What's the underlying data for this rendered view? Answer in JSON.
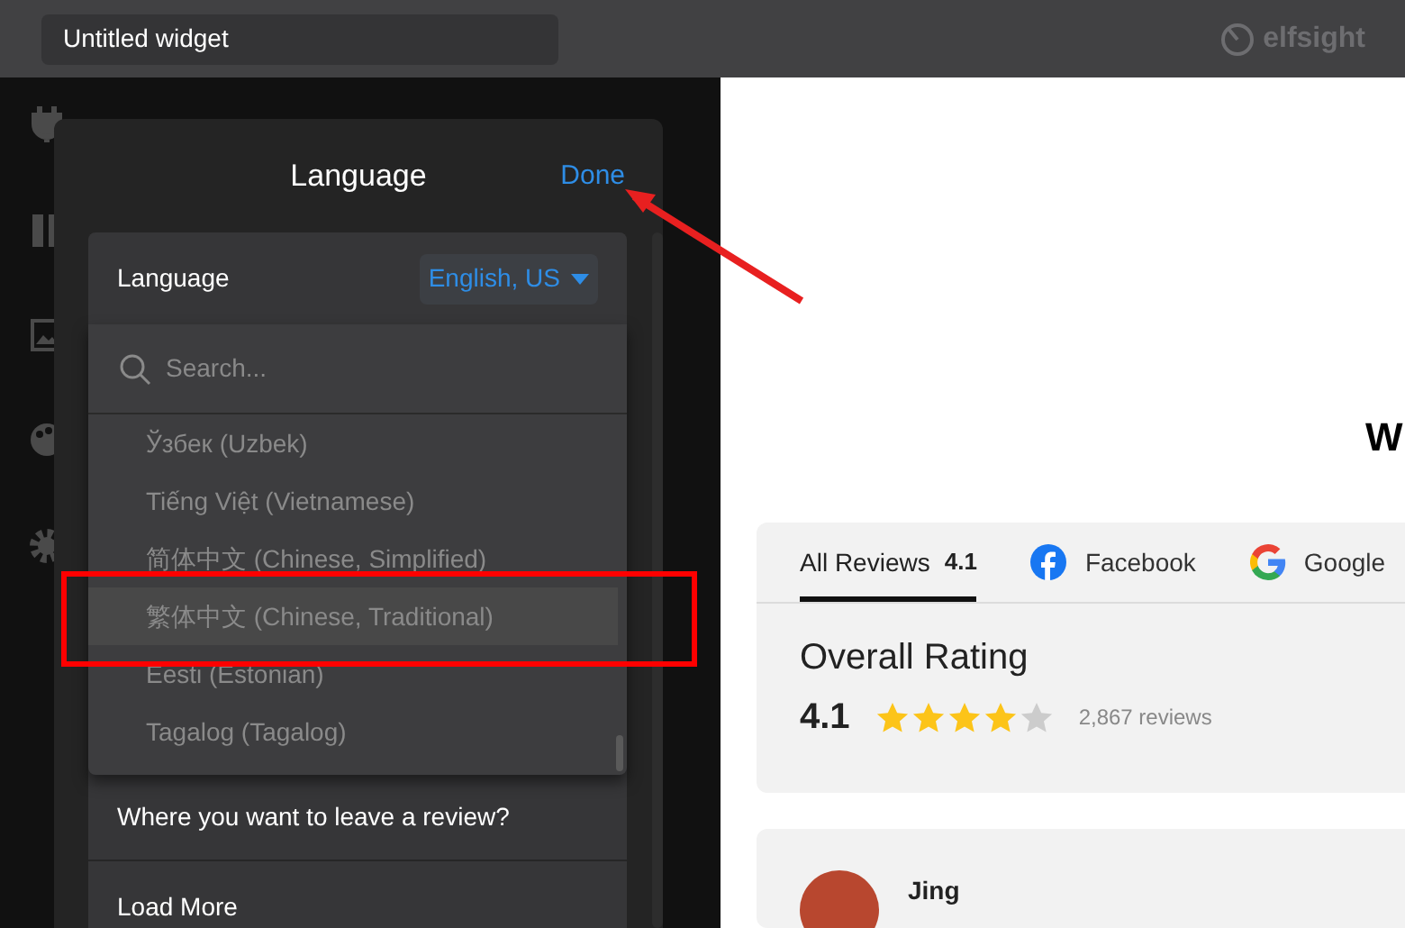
{
  "header": {
    "widget_name": "Untitled widget",
    "logo": "elfsight"
  },
  "panel": {
    "title": "Language",
    "done": "Done",
    "setting": {
      "label": "Language",
      "value": "English, US"
    },
    "dropdown": {
      "search_placeholder": "Search...",
      "options": [
        {
          "label": "Ўзбек (Uzbek)",
          "selected": false
        },
        {
          "label": "Tiếng Việt (Vietnamese)",
          "selected": false
        },
        {
          "label": "简体中文 (Chinese, Simplified)",
          "selected": false
        },
        {
          "label": "繁体中文 (Chinese, Traditional)",
          "selected": true
        },
        {
          "label": "Eesti (Estonian)",
          "selected": false
        },
        {
          "label": "Tagalog (Tagalog)",
          "selected": false
        }
      ]
    },
    "sections": [
      "Where you want to leave a review?",
      "Load More"
    ]
  },
  "preview": {
    "heading": "W",
    "tabs": [
      {
        "kind": "all",
        "label": "All Reviews",
        "rating": "4.1",
        "selected": true
      },
      {
        "kind": "facebook",
        "label": "Facebook",
        "selected": false
      },
      {
        "kind": "google",
        "label": "Google",
        "selected": false
      }
    ],
    "overall": {
      "title": "Overall Rating",
      "rating": "4.1",
      "stars": 4,
      "count": "2,867",
      "count_label": "reviews"
    },
    "review": {
      "author": "Jing"
    }
  }
}
